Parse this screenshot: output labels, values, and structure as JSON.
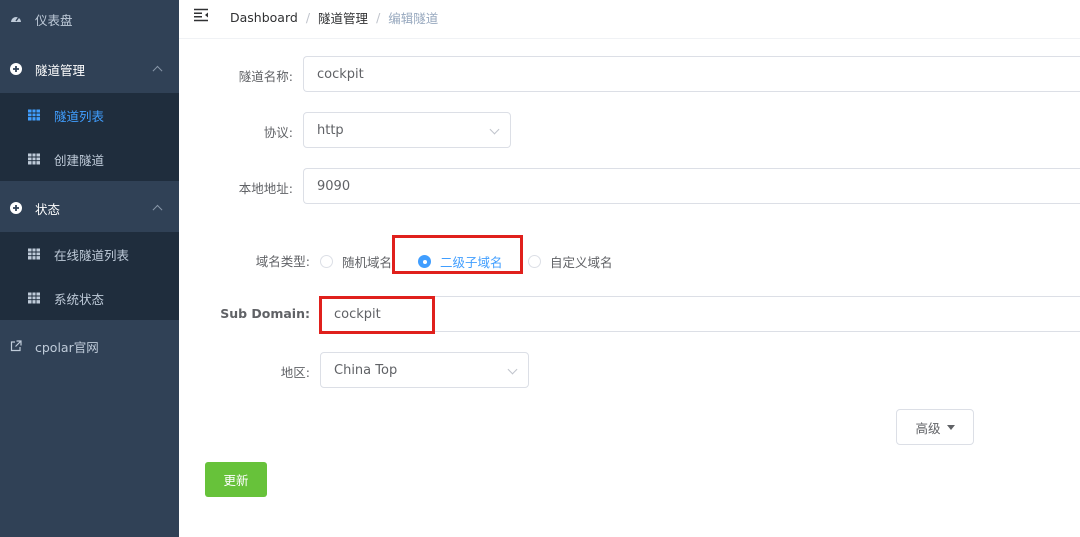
{
  "sidebar": {
    "dashboard": "仪表盘",
    "tunnel_management": "隧道管理",
    "tunnel_list": "隧道列表",
    "create_tunnel": "创建隧道",
    "status": "状态",
    "online_tunnels": "在线隧道列表",
    "system_status": "系统状态",
    "cpolar_site": "cpolar官网"
  },
  "breadcrumb": [
    "Dashboard",
    "隧道管理",
    "编辑隧道"
  ],
  "form": {
    "tunnel_name_label": "隧道名称:",
    "tunnel_name_value": "cockpit",
    "protocol_label": "协议:",
    "protocol_value": "http",
    "local_address_label": "本地地址:",
    "local_address_value": "9090",
    "domain_type_label": "域名类型:",
    "domain_types": [
      "随机域名",
      "二级子域名",
      "自定义域名"
    ],
    "domain_type_selected": "二级子域名",
    "sub_domain_label": "Sub Domain:",
    "sub_domain_value": "cockpit",
    "region_label": "地区:",
    "region_value": "China Top",
    "advanced_button": "高级",
    "update_button": "更新"
  },
  "colors": {
    "sidebar_bg": "#304156",
    "submenu_bg": "#1f2d3d",
    "active": "#409eff",
    "update_button": "#67c23a",
    "highlight_box": "#e0201c"
  }
}
